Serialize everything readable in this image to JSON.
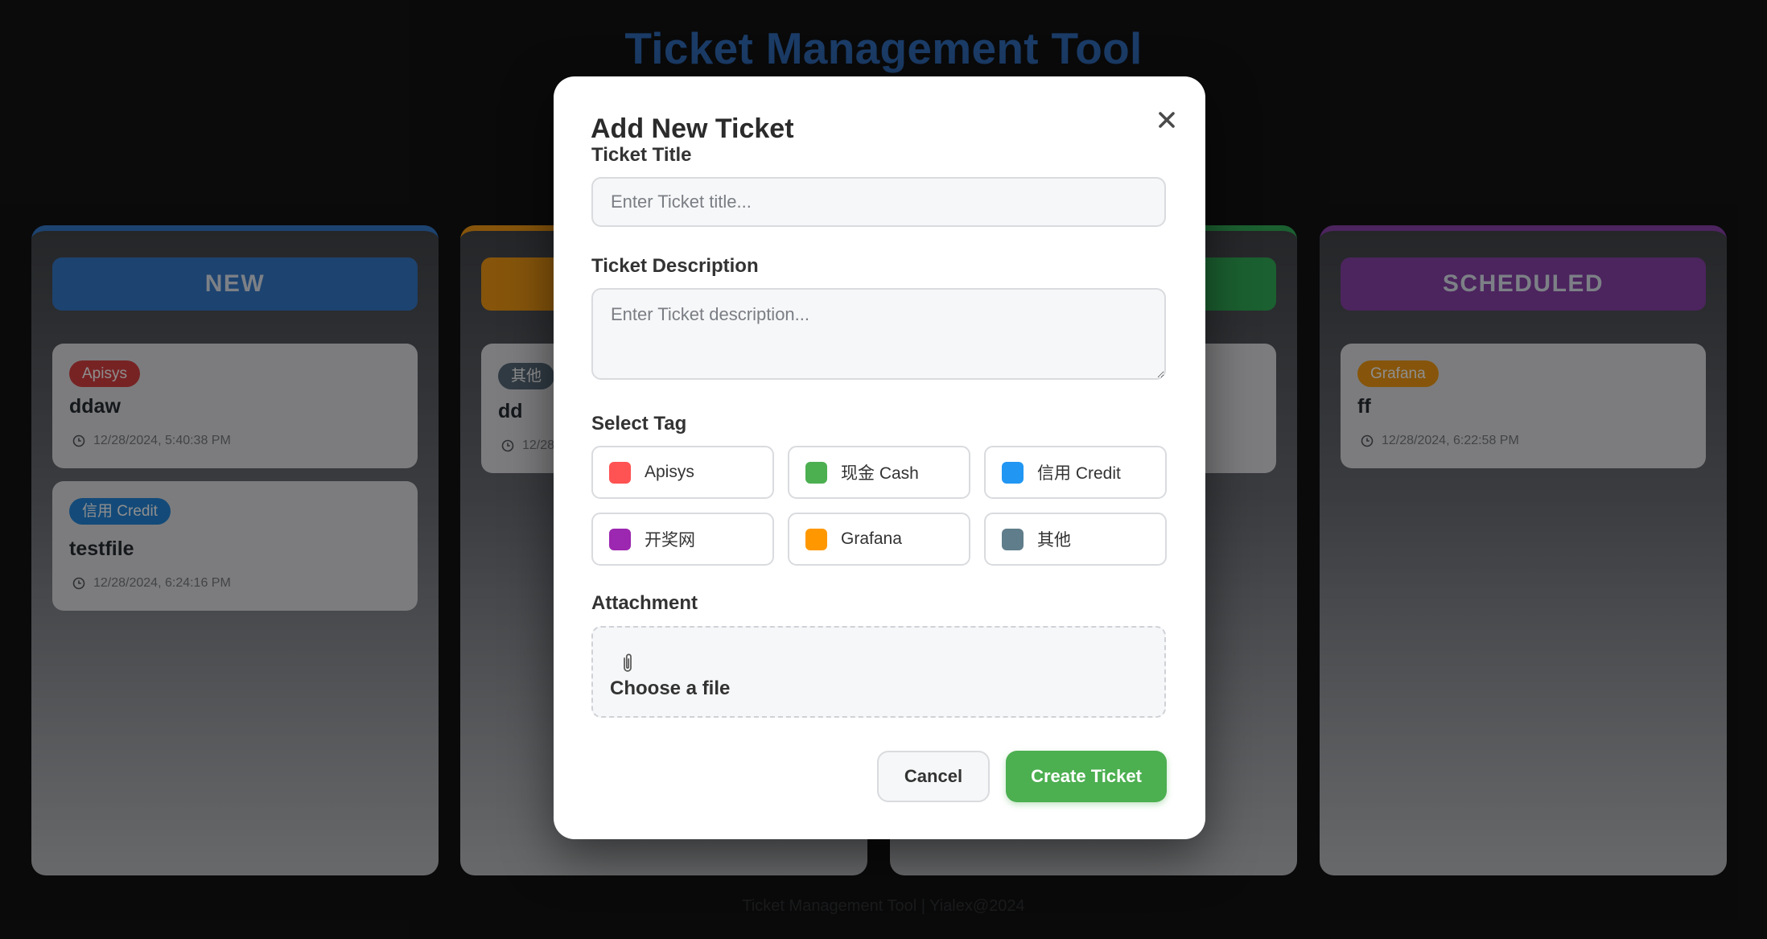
{
  "app": {
    "title": "Ticket Management Tool",
    "footer": "Ticket Management Tool | Yialex@2024"
  },
  "columns": [
    {
      "header": "NEW",
      "accent": "#2f6db5",
      "cards": [
        {
          "tag": "Apisys",
          "tag_color": "#c0393a",
          "title": "ddaw",
          "time": "12/28/2024, 5:40:38 PM"
        },
        {
          "tag": "信用 Credit",
          "tag_color": "#1f78c4",
          "title": "testfile",
          "time": "12/28/2024, 6:24:16 PM"
        }
      ]
    },
    {
      "header": "",
      "accent": "#d98a12",
      "cards": [
        {
          "tag": "其他",
          "tag_color": "#50606e",
          "title": "dd",
          "time": "12/28"
        }
      ]
    },
    {
      "header": "",
      "accent": "#2d9b4e",
      "cards": []
    },
    {
      "header": "SCHEDULED",
      "accent": "#7b3a98",
      "cards": [
        {
          "tag": "Grafana",
          "tag_color": "#d98a12",
          "title": "ff",
          "time": "12/28/2024, 6:22:58 PM"
        }
      ]
    }
  ],
  "modal": {
    "title": "Add New Ticket",
    "close_icon": "close-icon",
    "title_label": "Ticket Title",
    "title_placeholder": "Enter Ticket title...",
    "title_value": "",
    "description_label": "Ticket Description",
    "description_placeholder": "Enter Ticket description...",
    "description_value": "",
    "tag_label": "Select Tag",
    "tags": [
      {
        "label": "Apisys",
        "color": "#ff5252"
      },
      {
        "label": "现金 Cash",
        "color": "#4caf50"
      },
      {
        "label": "信用 Credit",
        "color": "#2196f3"
      },
      {
        "label": "开奖网",
        "color": "#9c27b0"
      },
      {
        "label": "Grafana",
        "color": "#ff9800"
      },
      {
        "label": "其他",
        "color": "#607d8b"
      }
    ],
    "attachment_label": "Attachment",
    "attachment_icon": "paperclip-icon",
    "choose_file_label": "Choose a file",
    "cancel_label": "Cancel",
    "create_label": "Create Ticket"
  }
}
